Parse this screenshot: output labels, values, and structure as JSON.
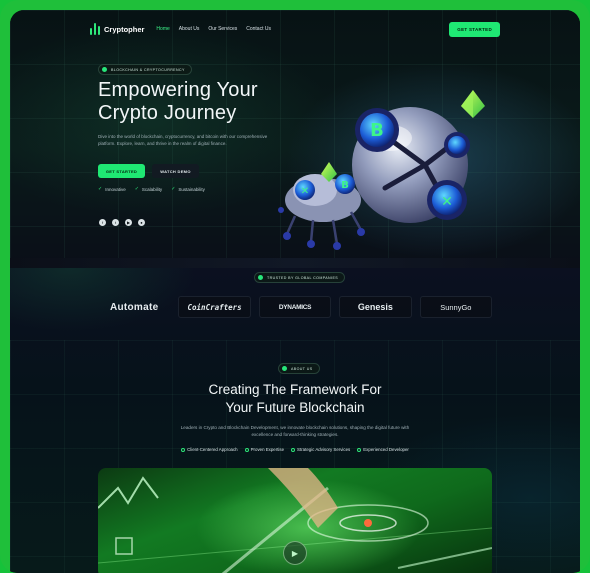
{
  "nav": {
    "brand": "Cryptopher",
    "links": [
      "Home",
      "About Us",
      "Our Services",
      "Contact Us"
    ],
    "cta": "GET STARTED"
  },
  "hero": {
    "badge": "BLOCKCHAIN & CRYPTOCURRENCY",
    "title_line1": "Empowering Your",
    "title_line2": "Crypto Journey",
    "description": "Dive into the world of blockchain, cryptocurrency, and bitcoin with our comprehensive platform. Explore, learn, and thrive in the realm of digital finance.",
    "primary_button": "GET STARTED",
    "secondary_button": "WATCH DEMO",
    "features": [
      "Innovative",
      "Scalability",
      "Sustainability"
    ],
    "socials": [
      "facebook-icon",
      "twitter-icon",
      "youtube-icon",
      "github-icon"
    ]
  },
  "trusted": {
    "badge": "TRUSTED BY GLOBAL COMPANIES",
    "brands": [
      "Automate",
      "CoinCrafters",
      "DYNAMICS",
      "Genesis",
      "SunnyGo"
    ]
  },
  "about": {
    "badge": "ABOUT US",
    "title_line1": "Creating The Framework For",
    "title_line2": "Your Future Blockchain",
    "description": "Leaders in Crypto and Blockchain Development, we innovate blockchain solutions, shaping the digital future with excellence and forward-thinking strategies.",
    "tags": [
      "Client-Centered Approach",
      "Proven Expertise",
      "Strategic Advisory Services",
      "Experienced Developer"
    ]
  },
  "colors": {
    "frame": "#1fbf3a",
    "accent": "#1fe873",
    "background": "#05080f"
  }
}
